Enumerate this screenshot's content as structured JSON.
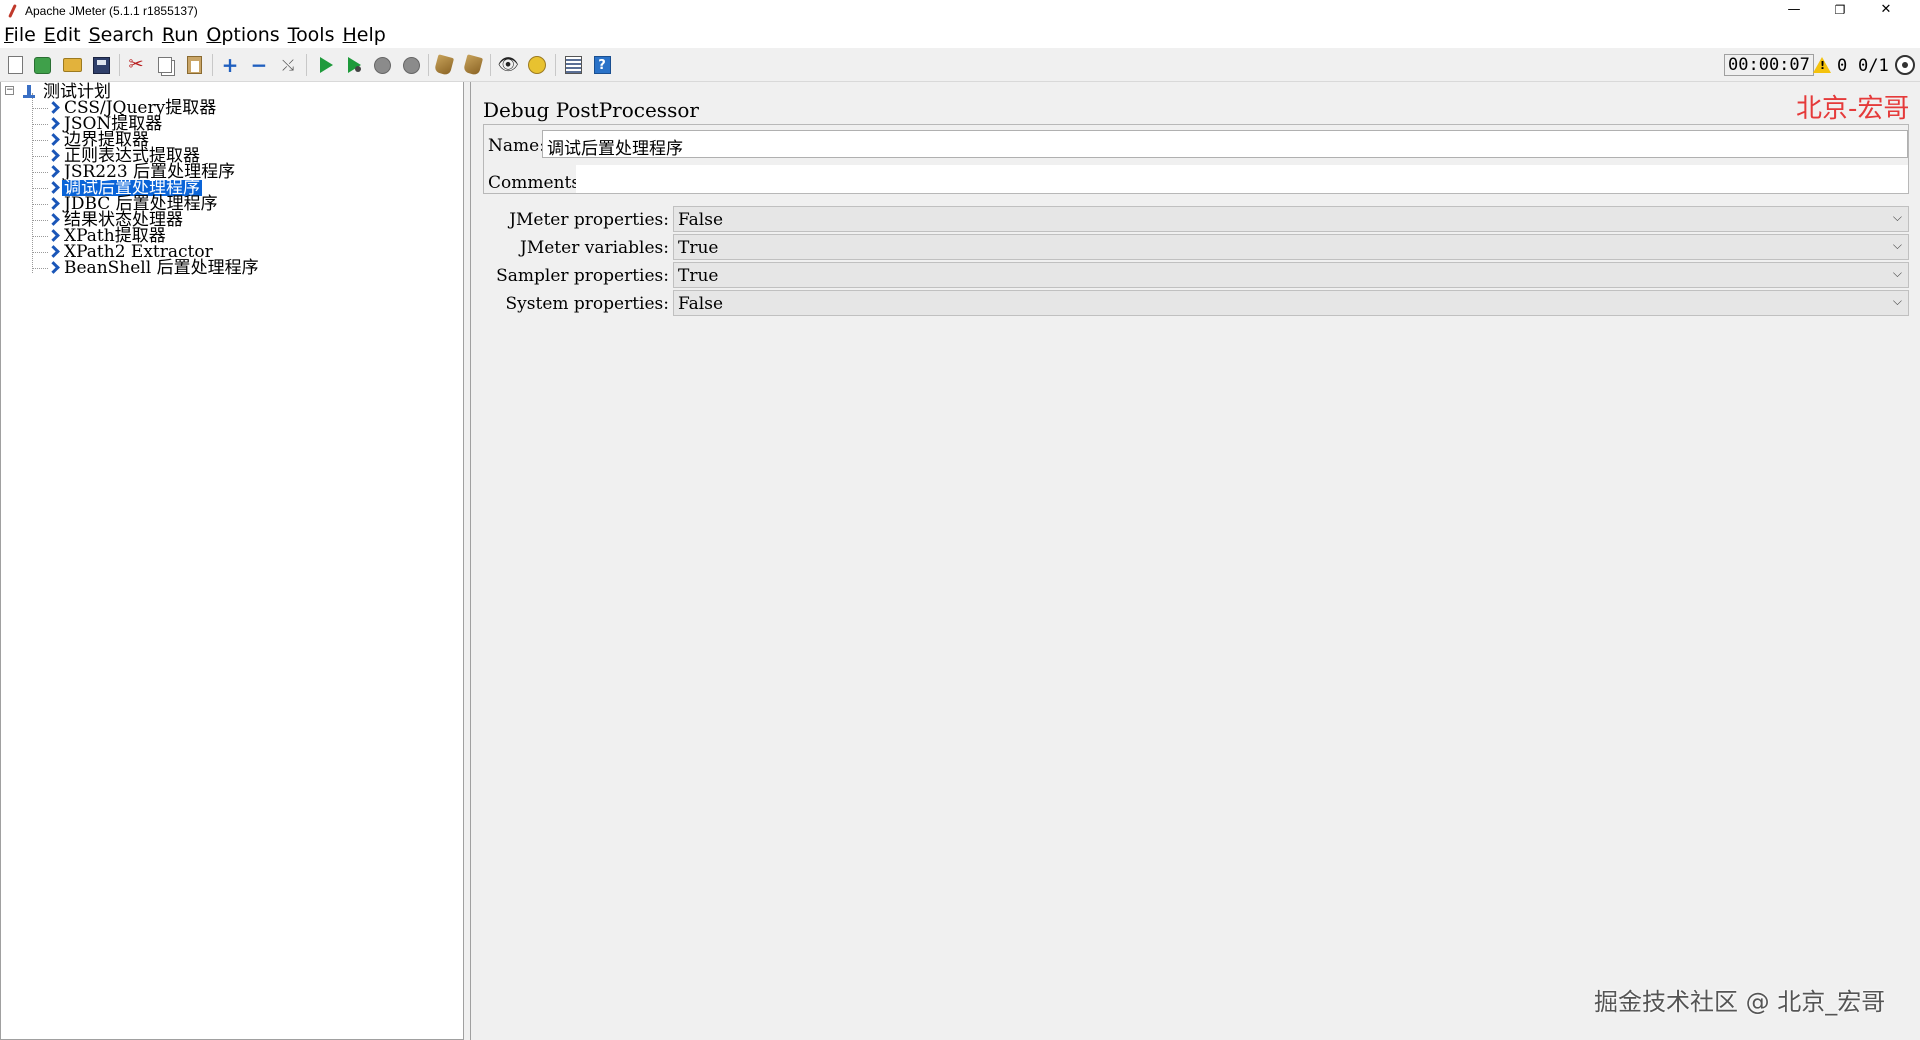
{
  "window": {
    "title": "Apache JMeter (5.1.1 r1855137)",
    "minimize": "—",
    "maximize": "❐",
    "close": "✕"
  },
  "menu": [
    "File",
    "Edit",
    "Search",
    "Run",
    "Options",
    "Tools",
    "Help"
  ],
  "toolbar": {
    "timer": "00:00:07",
    "error_count": "0",
    "threads": "0/1"
  },
  "tree": {
    "root": "测试计划",
    "items": [
      "CSS/JQuery提取器",
      "JSON提取器",
      "边界提取器",
      "正则表达式提取器",
      "JSR223 后置处理程序",
      "调试后置处理程序",
      "JDBC 后置处理程序",
      "结果状态处理器",
      "XPath提取器",
      "XPath2 Extractor",
      "BeanShell 后置处理程序"
    ],
    "selected_index": 5
  },
  "panel": {
    "title": "Debug PostProcessor",
    "watermark": "北京-宏哥",
    "name_label": "Name:",
    "name_value": "调试后置处理程序",
    "comments_label": "Comments:",
    "comments_value": "",
    "properties": [
      {
        "label": "JMeter properties:",
        "value": "False"
      },
      {
        "label": "JMeter variables:",
        "value": "True"
      },
      {
        "label": "Sampler properties:",
        "value": "True"
      },
      {
        "label": "System properties:",
        "value": "False"
      }
    ]
  },
  "footer_watermark": "掘金技术社区 @ 北京_宏哥",
  "colors": {
    "selection": "#0a64d8",
    "watermark_red": "#e53a3a",
    "run_green": "#1e9a3b"
  }
}
